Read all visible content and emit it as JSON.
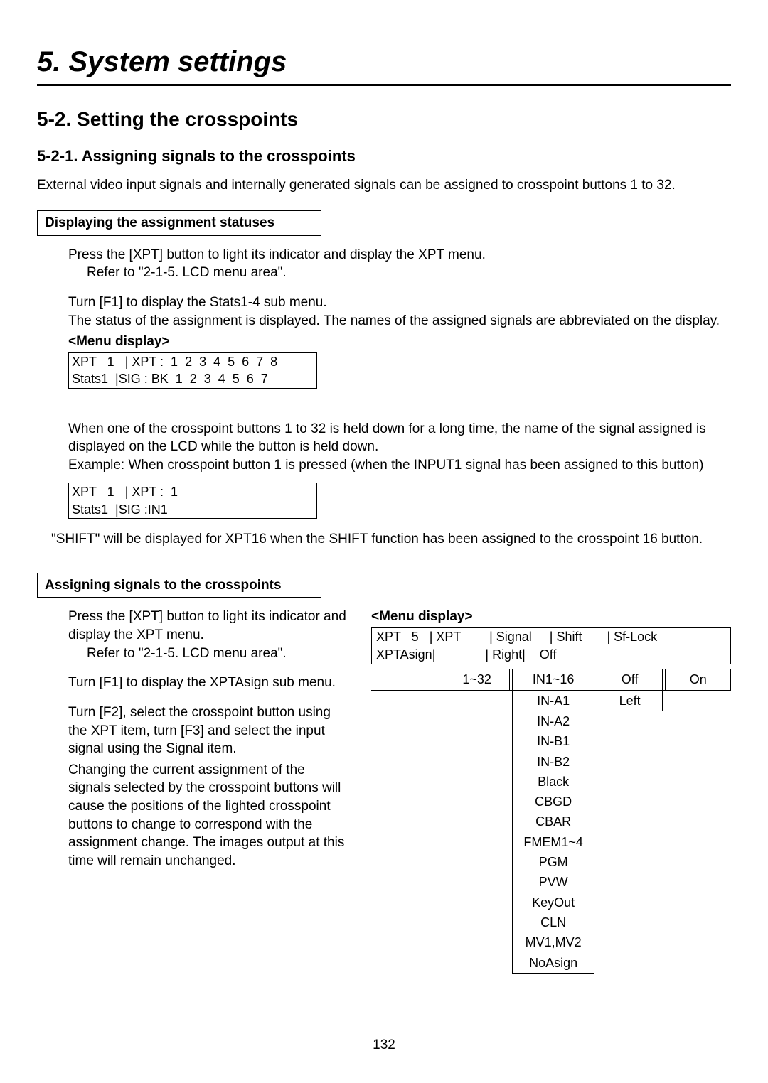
{
  "chapter": "5. System settings",
  "section": "5-2. Setting the crosspoints",
  "subsection": "5-2-1. Assigning signals to the crosspoints",
  "intro": "External video input signals and internally generated signals can be assigned to crosspoint buttons 1 to 32.",
  "label1": "Displaying the assignment statuses",
  "step1a": "Press the [XPT] button to light its indicator and display the XPT menu.",
  "step1a_ref": "Refer to \"2-1-5. LCD menu area\".",
  "step1b_l1": "Turn [F1] to display the Stats1-4 sub menu.",
  "step1b_l2": "The status of the assignment is displayed. The names of the assigned signals are abbreviated on the display.",
  "menu_label": "<Menu display>",
  "lcd1_l1": "XPT   1   | XPT :  1  2  3  4  5  6  7  8",
  "lcd1_l2": "Stats1  |SIG : BK  1  2  3  4  5  6  7",
  "note1_l1": "When one of the crosspoint buttons 1 to 32 is held down for a long time, the name of the signal assigned is displayed on the LCD while the button is held down.",
  "note1_l2": "Example: When crosspoint button 1 is pressed (when the INPUT1 signal has been assigned to this button)",
  "lcd2_l1": "XPT   1   | XPT :  1",
  "lcd2_l2": "Stats1  |SIG :IN1",
  "note2": "\"SHIFT\" will be displayed for XPT16 when the SHIFT function has been assigned to the crosspoint 16 button.",
  "label2": "Assigning signals to the crosspoints",
  "step2a": "Press the [XPT] button to light its indicator and display the XPT menu.",
  "step2a_ref": "Refer to \"2-1-5. LCD menu area\".",
  "step2b": "Turn [F1] to display the XPTAsign sub menu.",
  "step2c": "Turn [F2], select the crosspoint button using the XPT item, turn [F3] and select the input signal using the Signal item.",
  "step2d": "Changing the current assignment of the signals selected by the crosspoint buttons will cause the positions of the lighted crosspoint buttons to change to correspond with the assignment change.  The images output at this time will remain unchanged.",
  "lcd3_l1": "XPT   5   | XPT        | Signal     | Shift       | Sf-Lock",
  "lcd3_l2": "XPTAsign|              | Right|    Off",
  "opt_headers": {
    "c1": "",
    "c2": "1~32",
    "c3": "IN1~16",
    "c4": "Off",
    "c5": "On"
  },
  "signal_options": [
    "IN-A1",
    "IN-A2",
    "IN-B1",
    "IN-B2",
    "Black",
    "CBGD",
    "CBAR",
    "FMEM1~4",
    "PGM",
    "PVW",
    "KeyOut",
    "CLN",
    "MV1,MV2",
    "NoAsign"
  ],
  "shift_left": "Left",
  "page_number": "132"
}
